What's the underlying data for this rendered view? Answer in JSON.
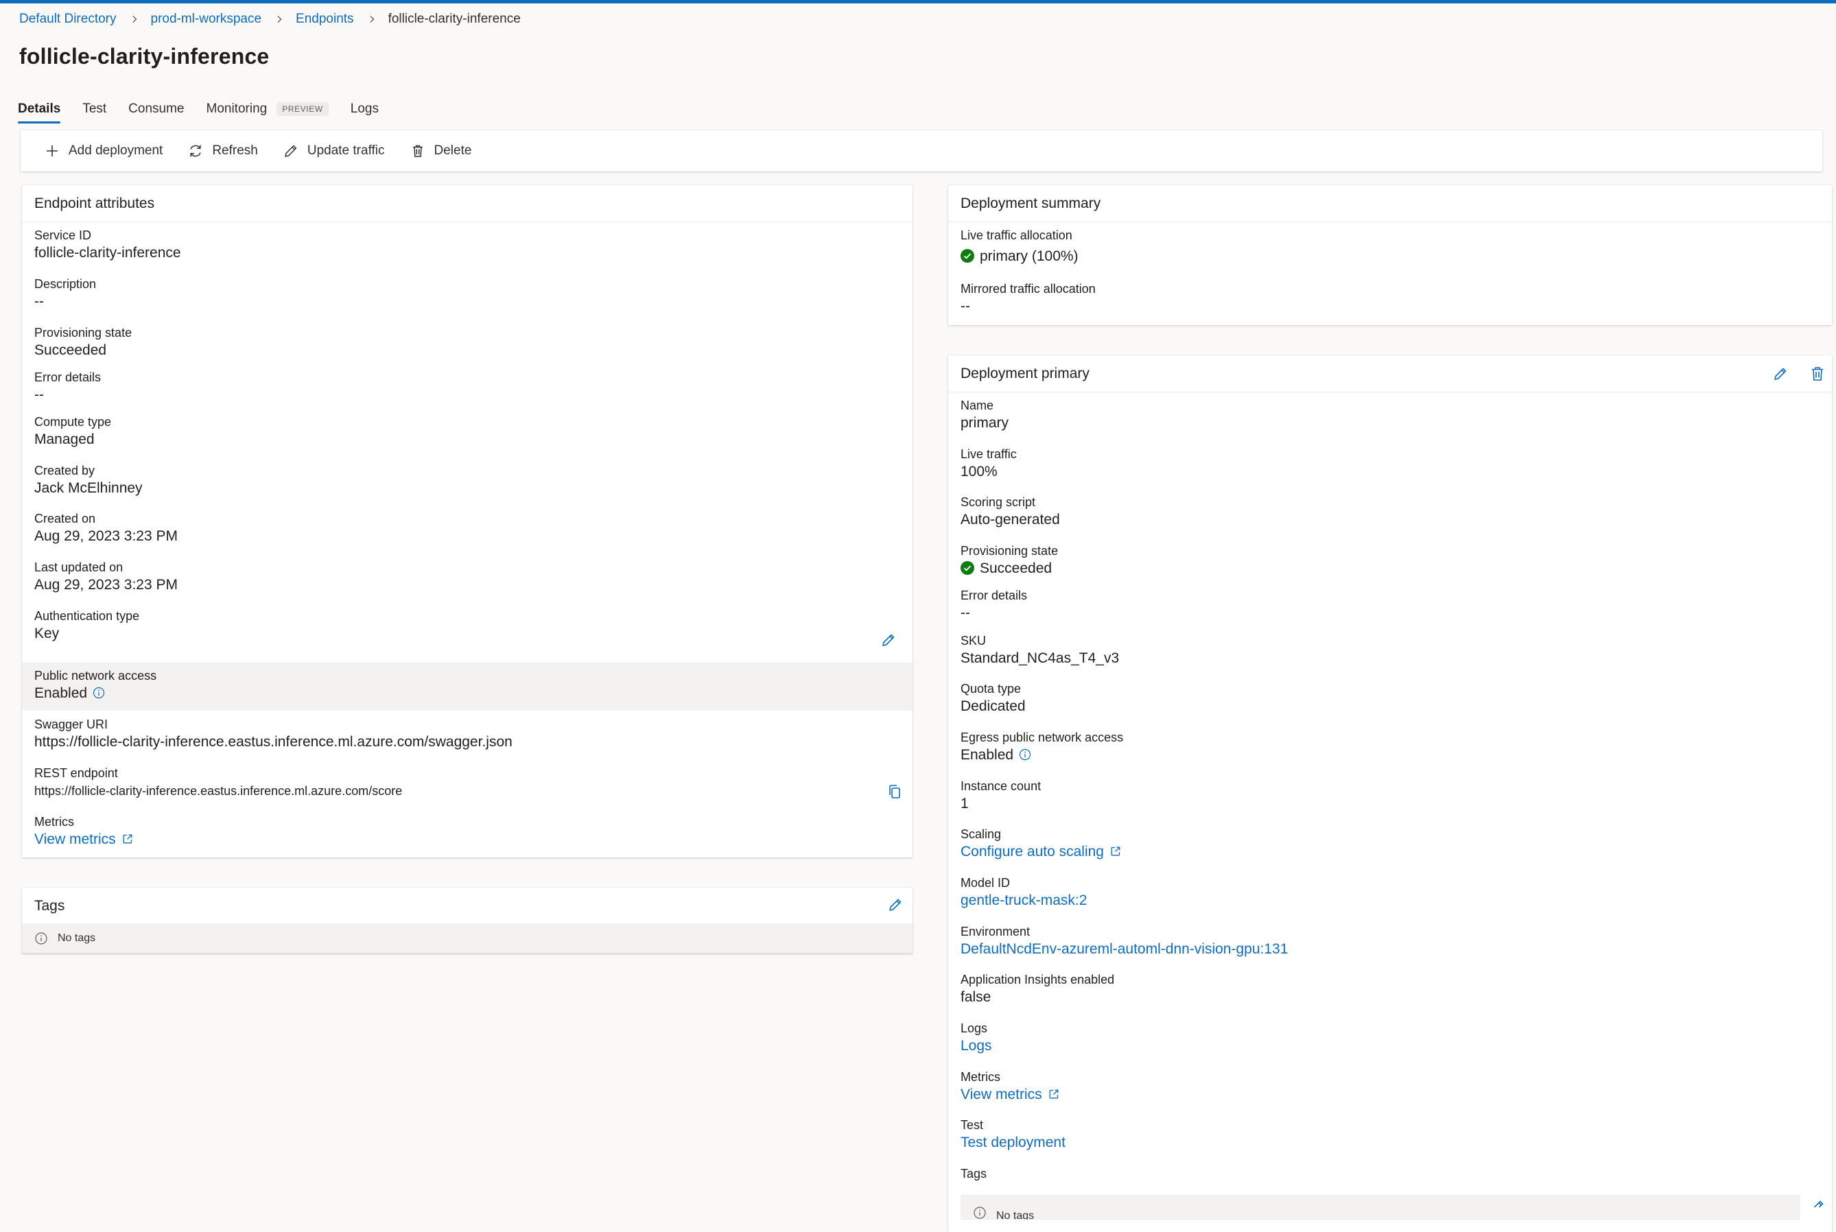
{
  "breadcrumb": {
    "items": [
      "Default Directory",
      "prod-ml-workspace",
      "Endpoints"
    ],
    "current": "follicle-clarity-inference"
  },
  "page_title": "follicle-clarity-inference",
  "tabs": [
    {
      "label": "Details",
      "active": true
    },
    {
      "label": "Test"
    },
    {
      "label": "Consume"
    },
    {
      "label": "Monitoring",
      "badge": "PREVIEW"
    },
    {
      "label": "Logs"
    }
  ],
  "toolbar": {
    "add": "Add deployment",
    "refresh": "Refresh",
    "update": "Update traffic",
    "delete": "Delete"
  },
  "endpoint": {
    "title": "Endpoint attributes",
    "service_id": {
      "label": "Service ID",
      "value": "follicle-clarity-inference"
    },
    "description": {
      "label": "Description",
      "value": "--"
    },
    "provisioning": {
      "label": "Provisioning state",
      "value": "Succeeded"
    },
    "error": {
      "label": "Error details",
      "value": "--"
    },
    "compute": {
      "label": "Compute type",
      "value": "Managed"
    },
    "created_by": {
      "label": "Created by",
      "value": "Jack McElhinney"
    },
    "created_on": {
      "label": "Created on",
      "value": "Aug 29, 2023 3:23 PM"
    },
    "updated_on": {
      "label": "Last updated on",
      "value": "Aug 29, 2023 3:23 PM"
    },
    "auth": {
      "label": "Authentication type",
      "value": "Key"
    },
    "network": {
      "label": "Public network access",
      "value": "Enabled"
    },
    "swagger": {
      "label": "Swagger URI",
      "value": "https://follicle-clarity-inference.eastus.inference.ml.azure.com/swagger.json"
    },
    "rest": {
      "label": "REST endpoint",
      "value": "https://follicle-clarity-inference.eastus.inference.ml.azure.com/score"
    },
    "metrics": {
      "label": "Metrics",
      "value": "View metrics"
    }
  },
  "tags": {
    "title": "Tags",
    "empty": "No tags"
  },
  "summary": {
    "title": "Deployment summary",
    "live": {
      "label": "Live traffic allocation",
      "value": "primary (100%)"
    },
    "mirrored": {
      "label": "Mirrored traffic allocation",
      "value": "--"
    }
  },
  "deployment": {
    "title": "Deployment primary",
    "name": {
      "label": "Name",
      "value": "primary"
    },
    "live": {
      "label": "Live traffic",
      "value": "100%"
    },
    "scoring": {
      "label": "Scoring script",
      "value": "Auto-generated"
    },
    "provisioning": {
      "label": "Provisioning state",
      "value": "Succeeded"
    },
    "error": {
      "label": "Error details",
      "value": "--"
    },
    "sku": {
      "label": "SKU",
      "value": "Standard_NC4as_T4_v3"
    },
    "quota": {
      "label": "Quota type",
      "value": "Dedicated"
    },
    "egress": {
      "label": "Egress public network access",
      "value": "Enabled"
    },
    "instances": {
      "label": "Instance count",
      "value": "1"
    },
    "scaling": {
      "label": "Scaling",
      "value": "Configure auto scaling"
    },
    "model": {
      "label": "Model ID",
      "value": "gentle-truck-mask:2"
    },
    "environment": {
      "label": "Environment",
      "value": "DefaultNcdEnv-azureml-automl-dnn-vision-gpu:131"
    },
    "insights": {
      "label": "Application Insights enabled",
      "value": "false"
    },
    "logs": {
      "label": "Logs",
      "value": "Logs"
    },
    "metrics": {
      "label": "Metrics",
      "value": "View metrics"
    },
    "test": {
      "label": "Test",
      "value": "Test deployment"
    },
    "tags": {
      "label": "Tags",
      "empty": "No tags"
    }
  },
  "colors": {
    "accent": "#0f6cbd",
    "success": "#107c10",
    "text": "#201f1e",
    "page_bg": "#faf9f8"
  }
}
